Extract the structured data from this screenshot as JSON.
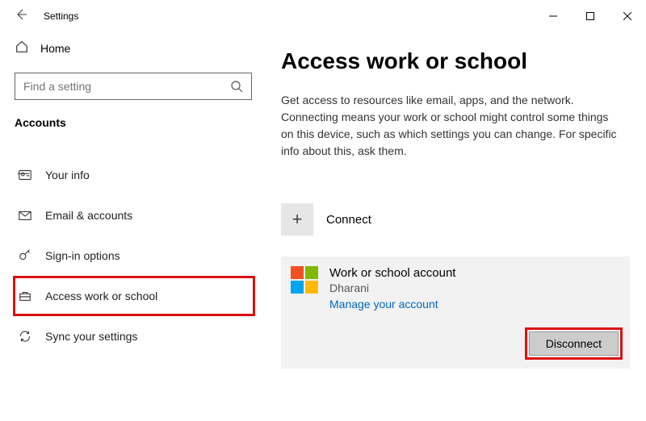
{
  "titlebar": {
    "title": "Settings"
  },
  "sidebar": {
    "home_label": "Home",
    "search_placeholder": "Find a setting",
    "section": "Accounts",
    "items": [
      {
        "label": "Your info"
      },
      {
        "label": "Email & accounts"
      },
      {
        "label": "Sign-in options"
      },
      {
        "label": "Access work or school"
      },
      {
        "label": "Sync your settings"
      }
    ]
  },
  "page": {
    "title": "Access work or school",
    "description": "Get access to resources like email, apps, and the network. Connecting means your work or school might control some things on this device, such as which settings you can change. For specific info about this, ask them.",
    "connect_label": "Connect",
    "account": {
      "title": "Work or school account",
      "subtitle": "Dharani",
      "manage_link": "Manage your account",
      "disconnect_label": "Disconnect"
    }
  }
}
